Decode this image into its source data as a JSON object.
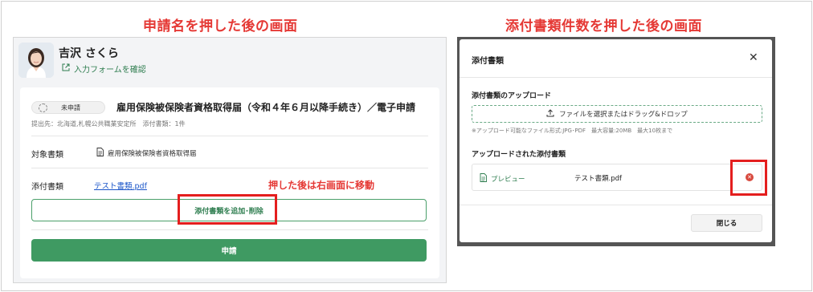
{
  "headings": {
    "left": "申請名を押した後の画面",
    "right": "添付書類件数を押した後の画面"
  },
  "user": {
    "name": "吉沢 さくら",
    "form_link": "入力フォームを確認"
  },
  "application": {
    "status": "未申請",
    "title": "雇用保険被保険者資格取得届（令和４年６月以降手続き）／電子申請",
    "submit_info": "提出先：北海道,札幌公共職業安定所　添付書類：1件",
    "target_label": "対象書類",
    "target_doc": "雇用保険被保険者資格取得届",
    "attach_label": "添付書類",
    "attach_file": "テスト書類.pdf",
    "annotation": "押した後は右画面に移動",
    "add_remove_label": "添付書類を追加･削除",
    "apply_label": "申請"
  },
  "modal": {
    "title": "添付書類",
    "upload_heading": "添付書類のアップロード",
    "dropzone_label": "ファイルを選択またはドラッグ&ドロップ",
    "upload_note": "※アップロード可能なファイル形式:JPG･PDF　最大容量:20MB　最大10枚まで",
    "uploaded_heading": "アップロードされた添付書類",
    "preview_label": "プレビュー",
    "file_name": "テスト書類.pdf",
    "close_label": "閉じる"
  },
  "colors": {
    "accent_green": "#3f9a62",
    "annotation_red": "#e53935",
    "link_blue": "#1a55c9"
  },
  "icons": [
    "external-link-icon",
    "document-icon",
    "upload-icon",
    "close-icon",
    "remove-icon",
    "dashed-circle-icon"
  ]
}
